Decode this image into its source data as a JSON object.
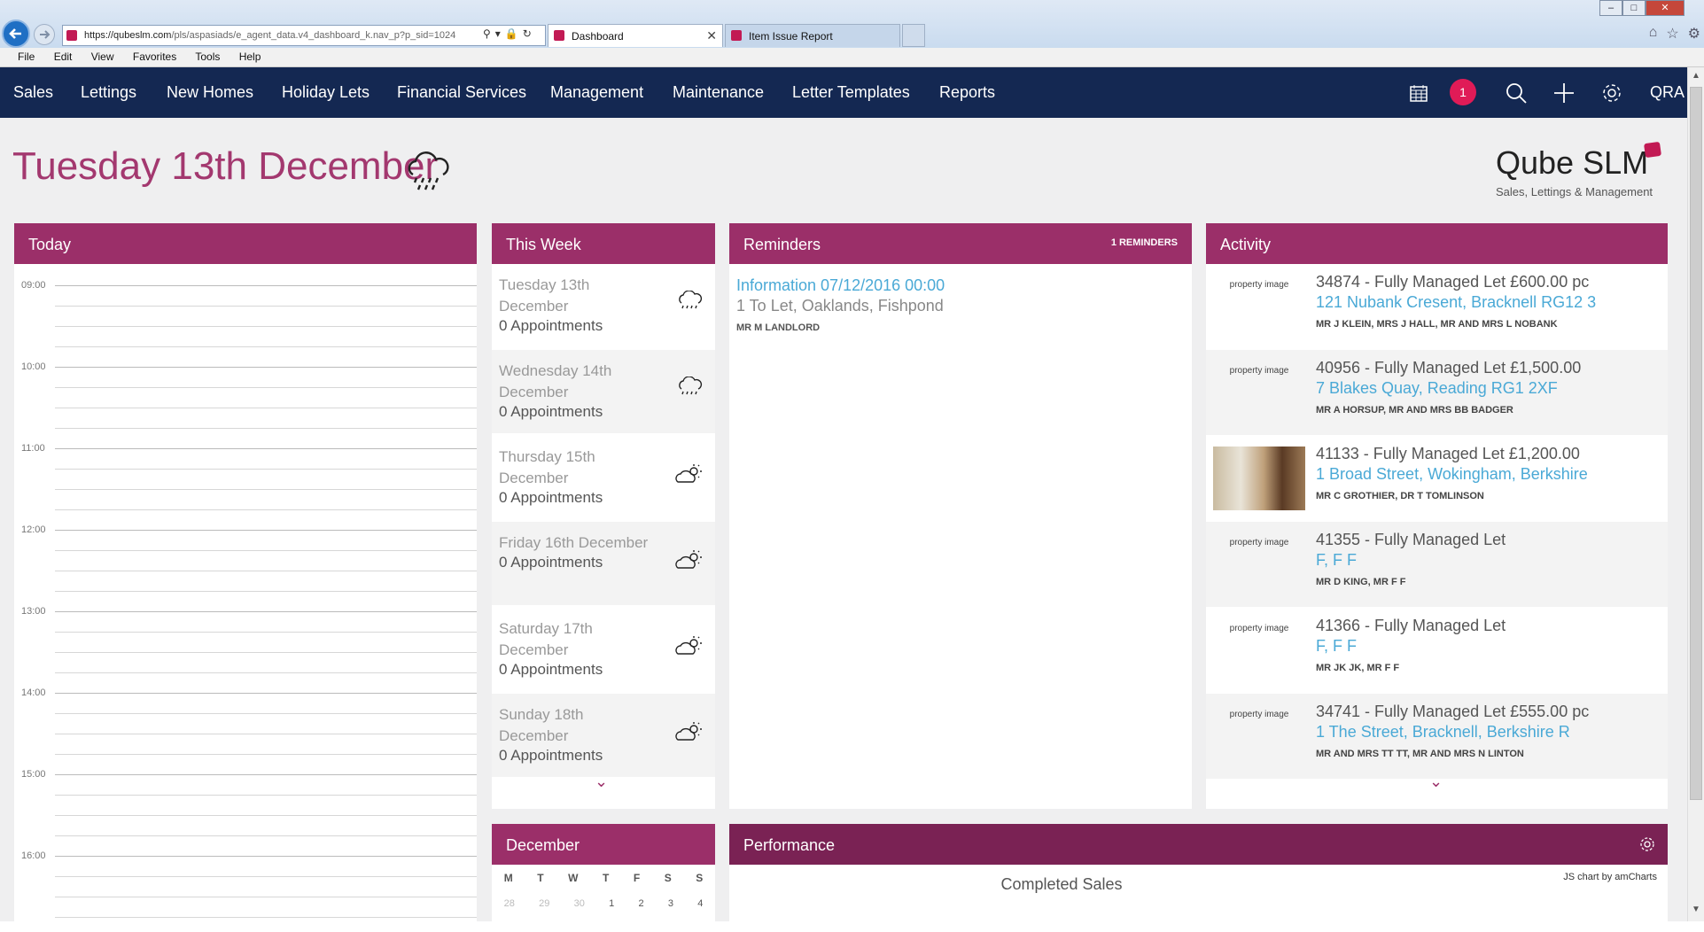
{
  "browser": {
    "address": {
      "host": "https://qubeslm.com",
      "path": "/pls/aspasiads/e_agent_data.v4_dashboard_k.nav_p?p_sid=1024"
    },
    "tabs": [
      {
        "label": "Dashboard"
      },
      {
        "label": "Item Issue Report"
      }
    ],
    "menu": [
      "File",
      "Edit",
      "View",
      "Favorites",
      "Tools",
      "Help"
    ]
  },
  "nav": {
    "items": [
      "Sales",
      "Lettings",
      "New Homes",
      "Holiday Lets",
      "Financial Services",
      "Management",
      "Maintenance",
      "Letter Templates",
      "Reports"
    ],
    "badge_count": "1",
    "user": "QRA"
  },
  "page": {
    "title": "Tuesday 13th December",
    "logo": "Qube SLM",
    "logo_sub": "Sales, Lettings & Management"
  },
  "today": {
    "header": "Today",
    "times": [
      "09:00",
      "10:00",
      "11:00",
      "12:00",
      "13:00",
      "14:00",
      "15:00",
      "16:00"
    ]
  },
  "week": {
    "header": "This Week",
    "days": [
      {
        "day": "Tuesday 13th December",
        "appts": "0 Appointments",
        "weather": "rain"
      },
      {
        "day": "Wednesday 14th December",
        "appts": "0 Appointments",
        "weather": "rain"
      },
      {
        "day": "Thursday 15th December",
        "appts": "0 Appointments",
        "weather": "partly-cloudy"
      },
      {
        "day": "Friday 16th December",
        "appts": "0 Appointments",
        "weather": "partly-cloudy"
      },
      {
        "day": "Saturday 17th December",
        "appts": "0 Appointments",
        "weather": "partly-cloudy"
      },
      {
        "day": "Sunday 18th December",
        "appts": "0 Appointments",
        "weather": "partly-cloudy"
      }
    ]
  },
  "reminders": {
    "header": "Reminders",
    "count": "1 REMINDERS",
    "items": [
      {
        "title": "Information 07/12/2016 00:00",
        "detail": "1 To Let, Oaklands, Fishpond",
        "person": "MR M LANDLORD"
      }
    ]
  },
  "activity": {
    "header": "Activity",
    "items": [
      {
        "img": "property image",
        "line1": "34874 - Fully Managed Let £600.00 pc",
        "line2": "121 Nubank Cresent, Bracknell RG12 3",
        "line3": "MR J KLEIN, MRS J HALL, MR AND MRS L NOBANK"
      },
      {
        "img": "property image",
        "line1": "40956 - Fully Managed Let £1,500.00",
        "line2": "7 Blakes Quay, Reading RG1 2XF",
        "line3": "MR A HORSUP, MR AND MRS BB BADGER"
      },
      {
        "img": "",
        "line1": "41133 - Fully Managed Let £1,200.00",
        "line2": "1 Broad Street, Wokingham, Berkshire",
        "line3": "MR C GROTHIER, DR T TOMLINSON"
      },
      {
        "img": "property image",
        "line1": "41355 - Fully Managed Let",
        "line2": "F, F F",
        "line3": "MR D KING, MR F F"
      },
      {
        "img": "property image",
        "line1": "41366 - Fully Managed Let",
        "line2": "F, F F",
        "line3": "MR JK JK, MR F F"
      },
      {
        "img": "property image",
        "line1": "34741 - Fully Managed Let £555.00 pc",
        "line2": "1 The Street, Bracknell, Berkshire R",
        "line3": "MR AND MRS TT TT, MR AND MRS N LINTON"
      }
    ]
  },
  "calendar": {
    "header": "December",
    "weekdays": [
      "M",
      "T",
      "W",
      "T",
      "F",
      "S",
      "S"
    ],
    "first_row": [
      "28",
      "29",
      "30",
      "1",
      "2",
      "3",
      "4"
    ]
  },
  "performance": {
    "header": "Performance",
    "chart_title": "Completed Sales",
    "credit": "JS chart by amCharts"
  },
  "colors": {
    "nav_bg": "#142852",
    "panel_header": "#9b2f69",
    "link": "#4aa9d6",
    "accent": "#a3386f",
    "badge": "#e01b57"
  }
}
